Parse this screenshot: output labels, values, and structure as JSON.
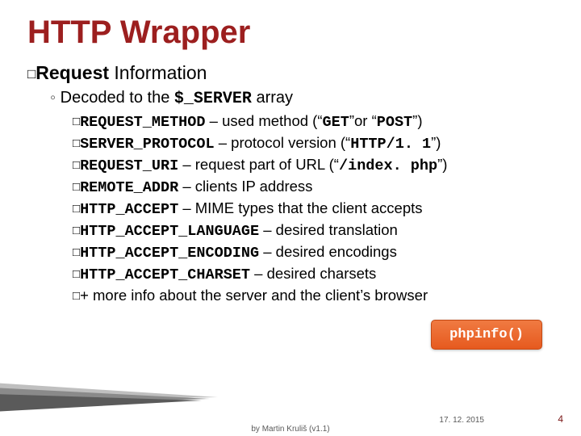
{
  "title": "HTTP Wrapper",
  "heading": {
    "bullet": "□",
    "bold": "Request",
    "rest": " Information"
  },
  "sub": {
    "marker": "◦",
    "pre": "Decoded to the ",
    "code": "$_SERVER",
    "post": " array"
  },
  "items": [
    {
      "bullet": "□",
      "code": "REQUEST_METHOD",
      "rest": " – used method (“",
      "code2": "GET",
      "mid": "”or “",
      "code3": "POST",
      "tail": "”)"
    },
    {
      "bullet": "□",
      "code": "SERVER_PROTOCOL",
      "rest": " – protocol version (“",
      "code2": "HTTP/1. 1",
      "mid": "”)",
      "code3": "",
      "tail": ""
    },
    {
      "bullet": "□",
      "code": "REQUEST_URI",
      "rest": " – request part of URL (“",
      "code2": "/index. php",
      "mid": "”)",
      "code3": "",
      "tail": ""
    },
    {
      "bullet": "□",
      "code": "REMOTE_ADDR",
      "rest": " – clients IP address",
      "code2": "",
      "mid": "",
      "code3": "",
      "tail": ""
    },
    {
      "bullet": "□",
      "code": "HTTP_ACCEPT",
      "rest": " – MIME types that the client accepts",
      "code2": "",
      "mid": "",
      "code3": "",
      "tail": ""
    },
    {
      "bullet": "□",
      "code": "HTTP_ACCEPT_LANGUAGE",
      "rest": " – desired translation",
      "code2": "",
      "mid": "",
      "code3": "",
      "tail": ""
    },
    {
      "bullet": "□",
      "code": "HTTP_ACCEPT_ENCODING",
      "rest": " – desired encodings",
      "code2": "",
      "mid": "",
      "code3": "",
      "tail": ""
    },
    {
      "bullet": "□",
      "code": "HTTP_ACCEPT_CHARSET",
      "rest": " – desired charsets",
      "code2": "",
      "mid": "",
      "code3": "",
      "tail": ""
    },
    {
      "bullet": "□",
      "code": "",
      "rest": "+ more info about the server and the client’s browser",
      "code2": "",
      "mid": "",
      "code3": "",
      "tail": ""
    }
  ],
  "callout": "phpinfo()",
  "footer": {
    "author": "by Martin Kruliš (v1.1)",
    "date": "17. 12. 2015",
    "slidenum": "4"
  }
}
